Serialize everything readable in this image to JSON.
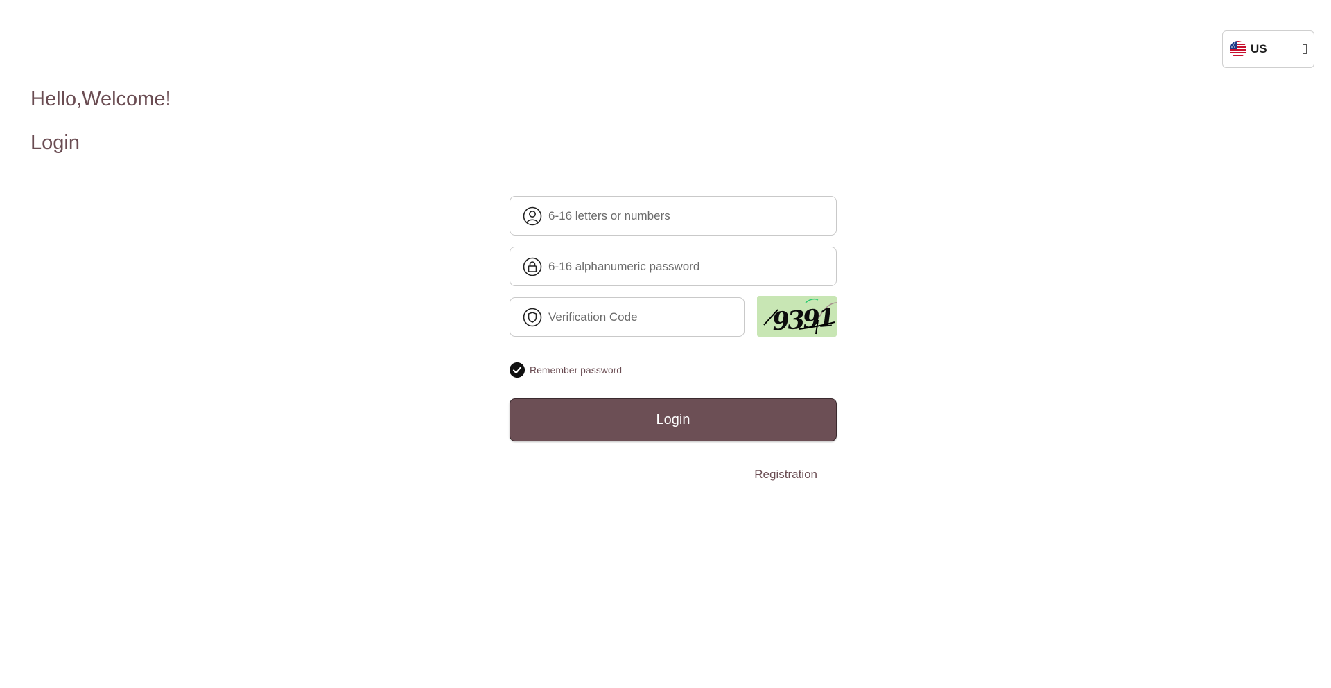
{
  "language_selector": {
    "code": "US",
    "flag_icon": "us-flag-icon",
    "dropdown_icon": "dropdown-indicator-icon"
  },
  "header": {
    "greeting": "Hello,Welcome!",
    "title": "Login"
  },
  "form": {
    "username": {
      "placeholder": "6-16 letters or numbers",
      "value": "",
      "icon": "user-icon"
    },
    "password": {
      "placeholder": "6-16 alphanumeric password",
      "value": "",
      "icon": "lock-icon"
    },
    "verification": {
      "placeholder": "Verification Code",
      "value": "",
      "icon": "shield-icon"
    },
    "captcha_text": "9391",
    "remember_label": "Remember password",
    "remember_checked": true,
    "login_label": "Login",
    "registration_label": "Registration"
  },
  "colors": {
    "accent": "#6c4f55",
    "text": "#6a4c52",
    "captcha_bg": "#c8e6b4"
  }
}
